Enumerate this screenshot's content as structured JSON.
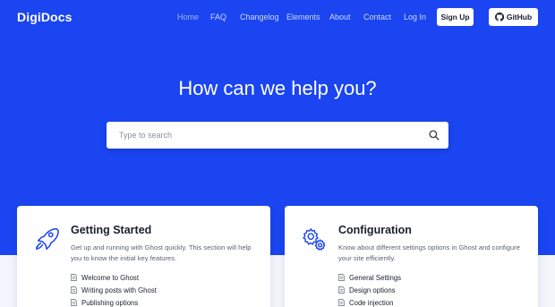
{
  "brand": "DigiDocs",
  "nav": {
    "links": [
      "Home",
      "FAQ",
      "Changelog",
      "Elements",
      "About",
      "Contact",
      "Log In"
    ],
    "signup": "Sign Up",
    "github": "GitHub"
  },
  "hero": {
    "headline": "How can we help you?",
    "search_placeholder": "Type to search",
    "search_value": ""
  },
  "colors": {
    "hero_bg": "#1a45f0",
    "accent": "#1a45f0"
  },
  "cards": [
    {
      "title": "Getting Started",
      "icon": "rocket-icon",
      "description": "Get up and running with Ghost quickly. This section will help you to know the initial key features.",
      "links": [
        "Welcome to Ghost",
        "Writing posts with Ghost",
        "Publishing options"
      ]
    },
    {
      "title": "Configuration",
      "icon": "gears-icon",
      "description": "Know about different settings options in Ghost and configure your site efficiently.",
      "links": [
        "General Settings",
        "Design options",
        "Code injection"
      ]
    }
  ]
}
